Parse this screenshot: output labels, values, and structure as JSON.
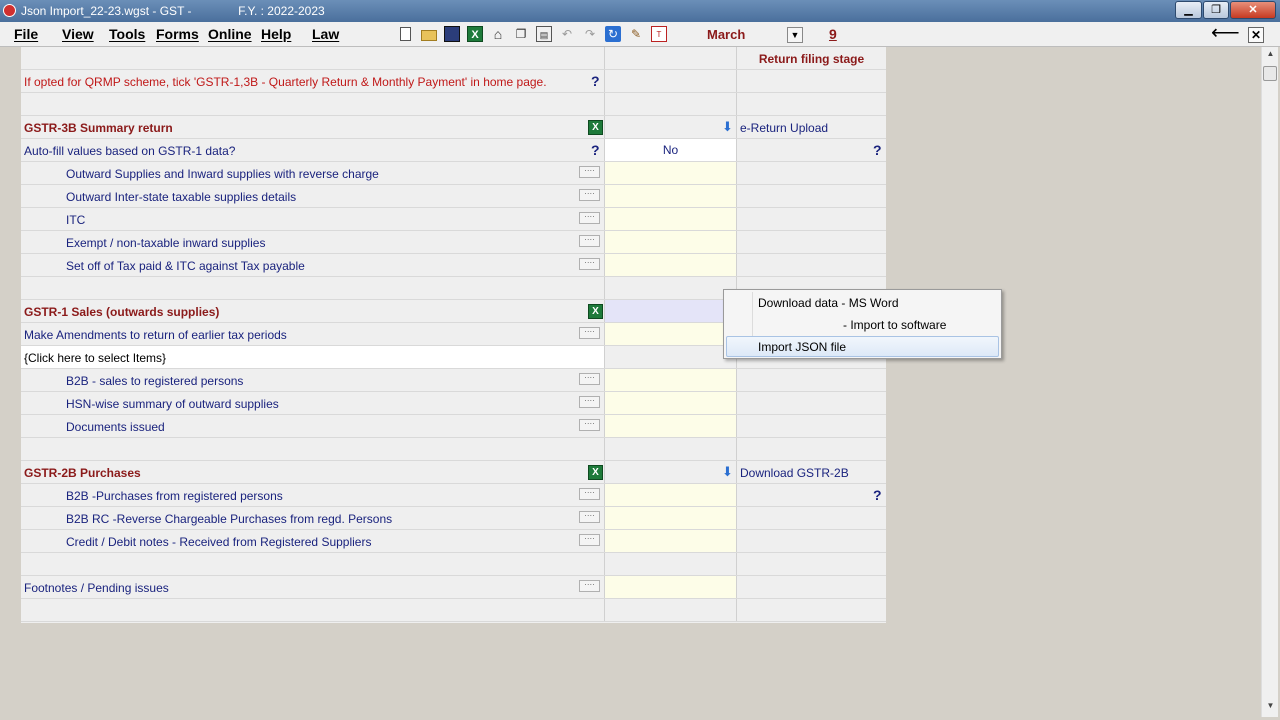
{
  "window": {
    "title": "Json Import_22-23.wgst - GST -              F.Y. : 2022-2023",
    "minimize": "▁",
    "maximize": "❐",
    "close": "✕"
  },
  "menu": {
    "file": "File",
    "view": "View",
    "tools": "Tools",
    "forms": "Forms",
    "online": "Online",
    "help": "Help",
    "law": "Law"
  },
  "toolbar": {
    "month": "March",
    "day": "9",
    "icons": [
      "new-doc-icon",
      "open-folder-icon",
      "save-icon",
      "excel-icon",
      "home-icon",
      "copy-icon",
      "print-preview-icon",
      "undo-icon",
      "redo-icon",
      "refresh-icon",
      "edit-icon",
      "tally-icon"
    ]
  },
  "grid": {
    "header_stage": "Return filing stage",
    "qrmp_note": "If opted for QRMP scheme, tick 'GSTR-1,3B - Quarterly Return & Monthly Payment' in home page.",
    "gstr3b_title": "GSTR-3B Summary return",
    "ereturn_upload": "e-Return Upload",
    "autofill_label": "Auto-fill values based on GSTR-1 data?",
    "autofill_value": "No",
    "gstr3b_items": [
      "Outward Supplies and Inward supplies with reverse charge",
      "Outward Inter-state taxable supplies details",
      "ITC",
      "Exempt / non-taxable inward supplies",
      "Set off of Tax paid & ITC against Tax payable"
    ],
    "gstr1_title": "GSTR-1   Sales (outwards supplies)",
    "amendments_label": "Make Amendments to return of earlier tax periods",
    "select_items": "{Click here to select Items}",
    "gstr1_items": [
      "B2B - sales to registered persons",
      "HSN-wise summary of outward supplies",
      "Documents issued"
    ],
    "gstr2b_title": "GSTR-2B   Purchases",
    "download_gstr2b": "Download GSTR-2B",
    "gstr2b_items": [
      "B2B -Purchases from registered persons",
      "B2B RC -Reverse Chargeable Purchases from regd. Persons",
      "Credit / Debit notes - Received from Registered Suppliers"
    ],
    "footnotes": "Footnotes / Pending issues",
    "qmark": "?",
    "ellipsis": "····",
    "excel_glyph": "X",
    "download_glyph": "⬇"
  },
  "popup": {
    "item1": "Download data - MS Word",
    "item2": "- Import to software",
    "item3": "Import JSON file"
  },
  "colors": {
    "heading": "#8b1a1a",
    "label": "#1a237e",
    "note": "#c01818",
    "input_bg": "#fdfde8"
  }
}
